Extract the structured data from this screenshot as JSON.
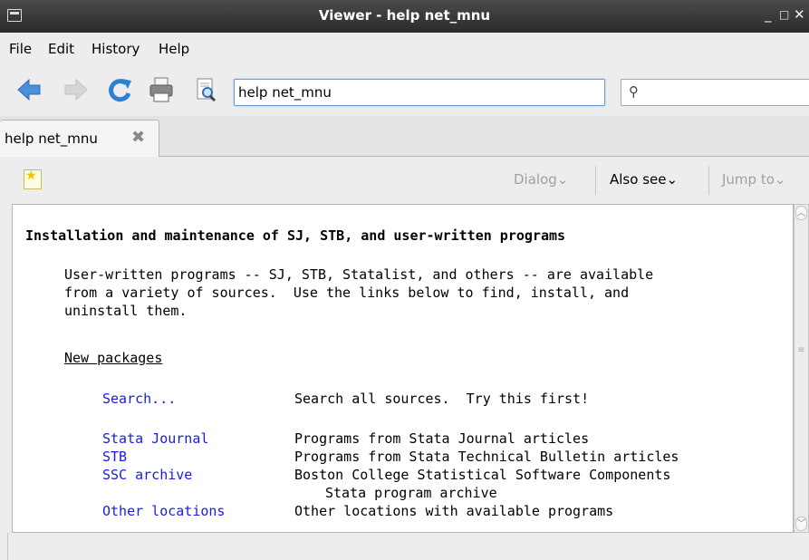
{
  "window": {
    "title": "Viewer - help net_mnu",
    "minimize": "_",
    "maximize": "□",
    "close": "✕"
  },
  "menu": [
    "File",
    "Edit",
    "History",
    "Help"
  ],
  "toolbar": {
    "url_value": "help net_mnu",
    "search_icon": "⚲"
  },
  "tab": {
    "label": "help net_mnu",
    "close": "✖"
  },
  "subbar": {
    "dialog": "Dialog",
    "also_see": "Also see",
    "jump_to": "Jump to",
    "chevron": "⌄"
  },
  "content": {
    "heading": "Installation and maintenance of SJ, STB, and user-written programs",
    "intro": [
      "User-written programs -- SJ, STB, Statalist, and others -- are available",
      "from a variety of sources.  Use the links below to find, install, and",
      "uninstall them."
    ],
    "section": "New packages",
    "rows": [
      {
        "link": "Search...",
        "desc": "Search all sources.  Try this first!"
      },
      {
        "link": "Stata Journal",
        "desc": "Programs from Stata Journal articles"
      },
      {
        "link": "STB",
        "desc": "Programs from Stata Technical Bulletin articles"
      },
      {
        "link": "SSC archive",
        "desc": "Boston College Statistical Software Components"
      },
      {
        "link": "",
        "desc": "Stata program archive"
      },
      {
        "link": "Other locations",
        "desc": "Other locations with available programs"
      }
    ]
  },
  "colors": {
    "link": "#1a1ae6",
    "titlebar": "#2b2b2b"
  }
}
